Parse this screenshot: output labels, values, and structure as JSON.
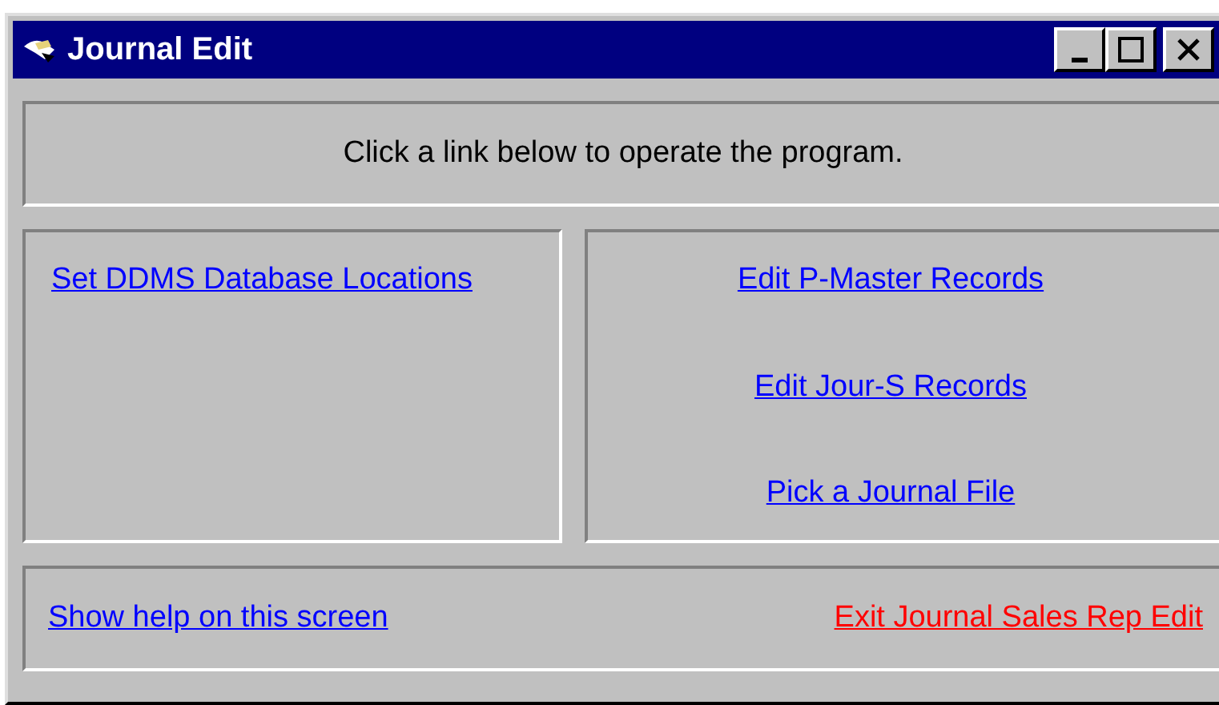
{
  "window": {
    "title": "Journal Edit"
  },
  "instruction": "Click a link below to operate the program.",
  "left_links": [
    {
      "label": "Set DDMS Database Locations",
      "color": "#0000ff"
    }
  ],
  "right_links": [
    {
      "label": "Edit P-Master Records",
      "color": "#0000ff"
    },
    {
      "label": "Edit Jour-S Records",
      "color": "#0000ff"
    },
    {
      "label": "Pick a Journal File",
      "color": "#0000ff"
    }
  ],
  "footer_links": [
    {
      "label": "Show help on this screen",
      "color": "#0000ff"
    },
    {
      "label": "Exit Journal Sales Rep Edit",
      "color": "#ff0000"
    }
  ]
}
